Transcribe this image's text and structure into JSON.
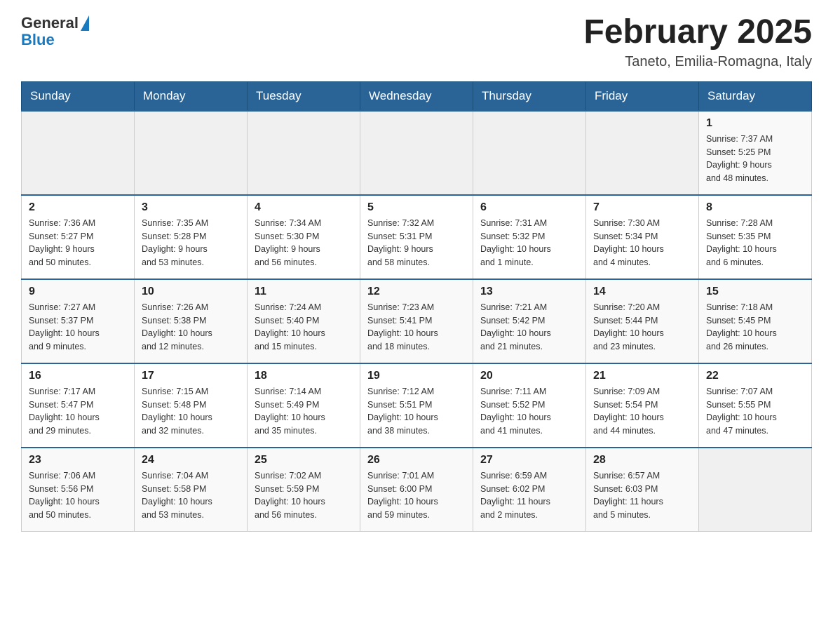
{
  "header": {
    "logo_general": "General",
    "logo_blue": "Blue",
    "month_title": "February 2025",
    "location": "Taneto, Emilia-Romagna, Italy"
  },
  "weekdays": [
    "Sunday",
    "Monday",
    "Tuesday",
    "Wednesday",
    "Thursday",
    "Friday",
    "Saturday"
  ],
  "weeks": [
    [
      {
        "day": "",
        "info": ""
      },
      {
        "day": "",
        "info": ""
      },
      {
        "day": "",
        "info": ""
      },
      {
        "day": "",
        "info": ""
      },
      {
        "day": "",
        "info": ""
      },
      {
        "day": "",
        "info": ""
      },
      {
        "day": "1",
        "info": "Sunrise: 7:37 AM\nSunset: 5:25 PM\nDaylight: 9 hours\nand 48 minutes."
      }
    ],
    [
      {
        "day": "2",
        "info": "Sunrise: 7:36 AM\nSunset: 5:27 PM\nDaylight: 9 hours\nand 50 minutes."
      },
      {
        "day": "3",
        "info": "Sunrise: 7:35 AM\nSunset: 5:28 PM\nDaylight: 9 hours\nand 53 minutes."
      },
      {
        "day": "4",
        "info": "Sunrise: 7:34 AM\nSunset: 5:30 PM\nDaylight: 9 hours\nand 56 minutes."
      },
      {
        "day": "5",
        "info": "Sunrise: 7:32 AM\nSunset: 5:31 PM\nDaylight: 9 hours\nand 58 minutes."
      },
      {
        "day": "6",
        "info": "Sunrise: 7:31 AM\nSunset: 5:32 PM\nDaylight: 10 hours\nand 1 minute."
      },
      {
        "day": "7",
        "info": "Sunrise: 7:30 AM\nSunset: 5:34 PM\nDaylight: 10 hours\nand 4 minutes."
      },
      {
        "day": "8",
        "info": "Sunrise: 7:28 AM\nSunset: 5:35 PM\nDaylight: 10 hours\nand 6 minutes."
      }
    ],
    [
      {
        "day": "9",
        "info": "Sunrise: 7:27 AM\nSunset: 5:37 PM\nDaylight: 10 hours\nand 9 minutes."
      },
      {
        "day": "10",
        "info": "Sunrise: 7:26 AM\nSunset: 5:38 PM\nDaylight: 10 hours\nand 12 minutes."
      },
      {
        "day": "11",
        "info": "Sunrise: 7:24 AM\nSunset: 5:40 PM\nDaylight: 10 hours\nand 15 minutes."
      },
      {
        "day": "12",
        "info": "Sunrise: 7:23 AM\nSunset: 5:41 PM\nDaylight: 10 hours\nand 18 minutes."
      },
      {
        "day": "13",
        "info": "Sunrise: 7:21 AM\nSunset: 5:42 PM\nDaylight: 10 hours\nand 21 minutes."
      },
      {
        "day": "14",
        "info": "Sunrise: 7:20 AM\nSunset: 5:44 PM\nDaylight: 10 hours\nand 23 minutes."
      },
      {
        "day": "15",
        "info": "Sunrise: 7:18 AM\nSunset: 5:45 PM\nDaylight: 10 hours\nand 26 minutes."
      }
    ],
    [
      {
        "day": "16",
        "info": "Sunrise: 7:17 AM\nSunset: 5:47 PM\nDaylight: 10 hours\nand 29 minutes."
      },
      {
        "day": "17",
        "info": "Sunrise: 7:15 AM\nSunset: 5:48 PM\nDaylight: 10 hours\nand 32 minutes."
      },
      {
        "day": "18",
        "info": "Sunrise: 7:14 AM\nSunset: 5:49 PM\nDaylight: 10 hours\nand 35 minutes."
      },
      {
        "day": "19",
        "info": "Sunrise: 7:12 AM\nSunset: 5:51 PM\nDaylight: 10 hours\nand 38 minutes."
      },
      {
        "day": "20",
        "info": "Sunrise: 7:11 AM\nSunset: 5:52 PM\nDaylight: 10 hours\nand 41 minutes."
      },
      {
        "day": "21",
        "info": "Sunrise: 7:09 AM\nSunset: 5:54 PM\nDaylight: 10 hours\nand 44 minutes."
      },
      {
        "day": "22",
        "info": "Sunrise: 7:07 AM\nSunset: 5:55 PM\nDaylight: 10 hours\nand 47 minutes."
      }
    ],
    [
      {
        "day": "23",
        "info": "Sunrise: 7:06 AM\nSunset: 5:56 PM\nDaylight: 10 hours\nand 50 minutes."
      },
      {
        "day": "24",
        "info": "Sunrise: 7:04 AM\nSunset: 5:58 PM\nDaylight: 10 hours\nand 53 minutes."
      },
      {
        "day": "25",
        "info": "Sunrise: 7:02 AM\nSunset: 5:59 PM\nDaylight: 10 hours\nand 56 minutes."
      },
      {
        "day": "26",
        "info": "Sunrise: 7:01 AM\nSunset: 6:00 PM\nDaylight: 10 hours\nand 59 minutes."
      },
      {
        "day": "27",
        "info": "Sunrise: 6:59 AM\nSunset: 6:02 PM\nDaylight: 11 hours\nand 2 minutes."
      },
      {
        "day": "28",
        "info": "Sunrise: 6:57 AM\nSunset: 6:03 PM\nDaylight: 11 hours\nand 5 minutes."
      },
      {
        "day": "",
        "info": ""
      }
    ]
  ]
}
